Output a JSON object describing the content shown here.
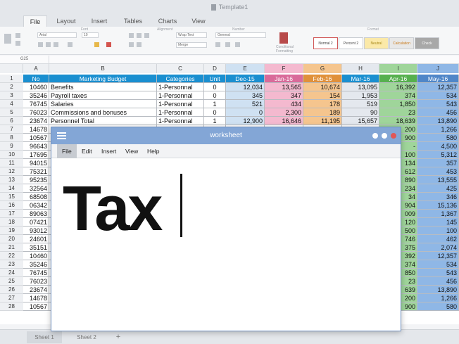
{
  "app": {
    "title": "Template1"
  },
  "tabs": [
    "File",
    "Layout",
    "Insert",
    "Tables",
    "Charts",
    "View"
  ],
  "ribbon": {
    "groups": [
      "Font",
      "Alignment",
      "Number",
      "Format"
    ],
    "font_name": "Arial",
    "font_size": "10",
    "wrap": "Wrap Text",
    "merge": "Merge",
    "number_format": "General",
    "cf_label": "Conditional Formatting",
    "styles": [
      "Normal 2",
      "Percent 2",
      "Neutral",
      "Calculation",
      "Check"
    ]
  },
  "namebox": "G25",
  "columns": [
    "",
    "A",
    "B",
    "C",
    "D",
    "E",
    "F",
    "G",
    "H",
    "I",
    "J"
  ],
  "rownums": [
    "1",
    "2",
    "3",
    "4",
    "5",
    "6",
    "7",
    "8",
    "9",
    "10",
    "11",
    "12",
    "13",
    "14",
    "15",
    "16",
    "17",
    "18",
    "19",
    "20",
    "21",
    "22",
    "23",
    "24",
    "25",
    "26",
    "27",
    "28"
  ],
  "header": [
    "No",
    "Marketing Budget",
    "Categories",
    "Unit",
    "Dec-15",
    "Jan-16",
    "Feb-16",
    "Mar-16",
    "Apr-16",
    "May-16"
  ],
  "rows": [
    [
      "10460",
      "Benefits",
      "1-Personnal",
      "0",
      "12,034",
      "13,565",
      "10,674",
      "13,095",
      "16,392",
      "12,357"
    ],
    [
      "35246",
      "Payroll taxes",
      "1-Personnal",
      "0",
      "345",
      "347",
      "154",
      "1,953",
      "374",
      "534"
    ],
    [
      "76745",
      "Salaries",
      "1-Personnal",
      "1",
      "521",
      "434",
      "178",
      "519",
      "1,850",
      "543"
    ],
    [
      "76023",
      "Commissions and bonuses",
      "1-Personnal",
      "0",
      "0",
      "2,300",
      "189",
      "90",
      "23",
      "456"
    ],
    [
      "23674",
      "Personnel Total",
      "1-Personnal",
      "1",
      "12,900",
      "16,646",
      "11,195",
      "15,657",
      "18,639",
      "13,890"
    ],
    [
      "14678",
      "",
      "",
      "",
      "",
      "",
      "",
      "",
      "200",
      "1,266"
    ],
    [
      "10567",
      "",
      "",
      "",
      "",
      "",
      "",
      "",
      "900",
      "580"
    ],
    [
      "96643",
      "",
      "",
      "",
      "",
      "",
      "",
      "",
      "-",
      "4,500"
    ],
    [
      "17695",
      "",
      "",
      "",
      "",
      "",
      "",
      "",
      "100",
      "5,312"
    ],
    [
      "94015",
      "",
      "",
      "",
      "",
      "",
      "",
      "",
      "134",
      "357"
    ],
    [
      "75321",
      "",
      "",
      "",
      "",
      "",
      "",
      "",
      "612",
      "453"
    ],
    [
      "95235",
      "",
      "",
      "",
      "",
      "",
      "",
      "",
      "890",
      "13,555"
    ],
    [
      "32564",
      "",
      "",
      "",
      "",
      "",
      "",
      "",
      "234",
      "425"
    ],
    [
      "68508",
      "",
      "",
      "",
      "",
      "",
      "",
      "",
      "34",
      "346"
    ],
    [
      "06342",
      "",
      "",
      "",
      "",
      "",
      "",
      "",
      "904",
      "15,136"
    ],
    [
      "89063",
      "",
      "",
      "",
      "",
      "",
      "",
      "",
      "009",
      "1,367"
    ],
    [
      "07421",
      "",
      "",
      "",
      "",
      "",
      "",
      "",
      "120",
      "145"
    ],
    [
      "93012",
      "",
      "",
      "",
      "",
      "",
      "",
      "",
      "500",
      "100"
    ],
    [
      "24601",
      "",
      "",
      "",
      "",
      "",
      "",
      "",
      "746",
      "462"
    ],
    [
      "35151",
      "",
      "",
      "",
      "",
      "",
      "",
      "",
      "375",
      "2,074"
    ],
    [
      "10460",
      "",
      "",
      "",
      "",
      "",
      "",
      "",
      "392",
      "12,357"
    ],
    [
      "35246",
      "",
      "",
      "",
      "",
      "",
      "",
      "",
      "374",
      "534"
    ],
    [
      "76745",
      "",
      "",
      "",
      "",
      "",
      "",
      "",
      "850",
      "543"
    ],
    [
      "76023",
      "",
      "",
      "",
      "",
      "",
      "",
      "",
      "23",
      "456"
    ],
    [
      "23674",
      "",
      "",
      "",
      "",
      "",
      "",
      "",
      "639",
      "13,890"
    ],
    [
      "14678",
      "",
      "",
      "",
      "",
      "",
      "",
      "",
      "200",
      "1,266"
    ],
    [
      "10567",
      "",
      "",
      "",
      "",
      "",
      "",
      "",
      "900",
      "580"
    ]
  ],
  "sheets": [
    "Sheet 1",
    "Sheet 2",
    "+"
  ],
  "popup": {
    "title": "worksheet",
    "menu": [
      "File",
      "Edit",
      "Insert",
      "View",
      "Help"
    ],
    "text": "Tax"
  },
  "colors": {
    "accent": "#1a8fd0",
    "jan": "#f4b9cf",
    "feb": "#f5c58e",
    "apr": "#9fd59a",
    "may": "#8fb7e6",
    "dec": "#cfe1f2",
    "mar": "#e4e8ee"
  }
}
